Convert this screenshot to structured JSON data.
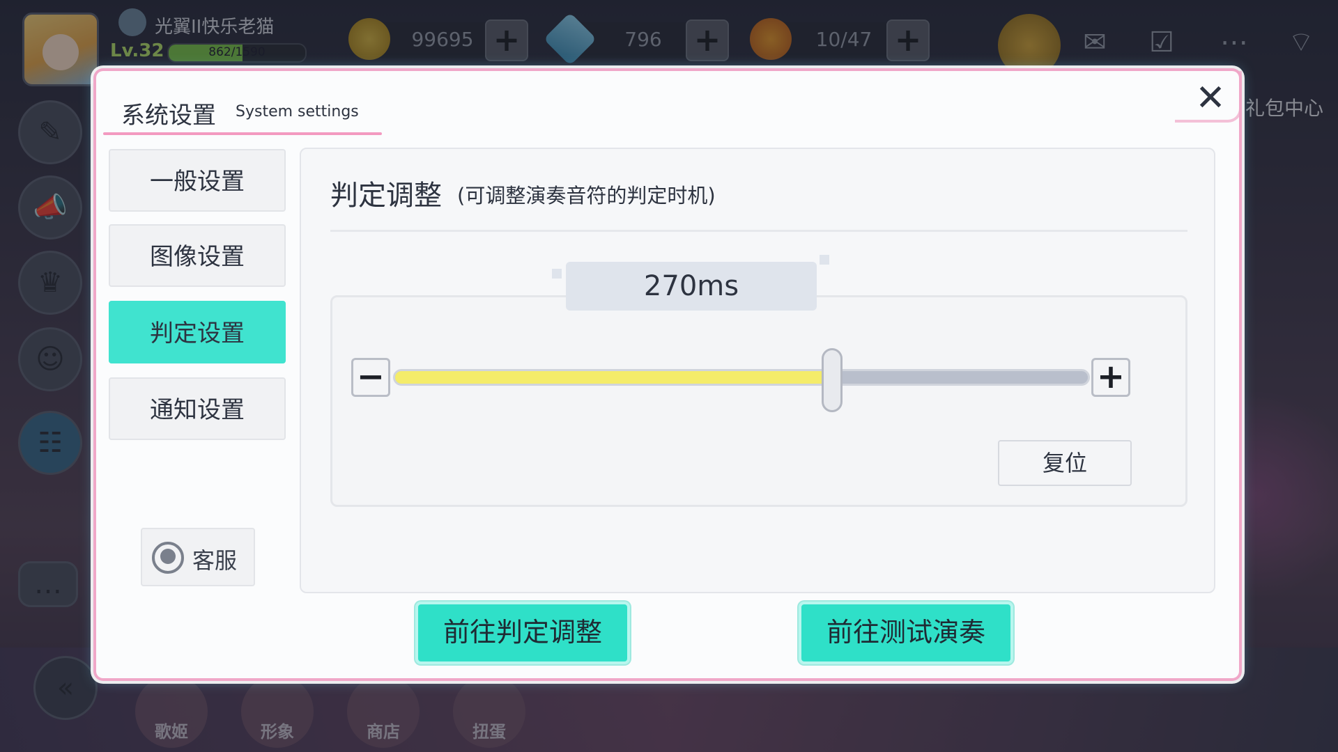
{
  "player": {
    "name": "光翼II快乐老猫",
    "level": "Lv.32",
    "exp_text": "862/1590",
    "exp_fraction": 0.542
  },
  "resources": [
    {
      "icon": "gold-coin-icon",
      "value": "99695"
    },
    {
      "icon": "diamond-icon",
      "value": "796"
    },
    {
      "icon": "stamina-sun-icon",
      "value": "10/47"
    }
  ],
  "right_panel": {
    "gift_center": "礼包中心"
  },
  "bottom_nav": [
    "歌姬",
    "形象",
    "商店",
    "扭蛋"
  ],
  "modal": {
    "title_cn": "系统设置",
    "title_en": "System settings",
    "close": "✕"
  },
  "side_nav": {
    "items": [
      "一般设置",
      "图像设置",
      "判定设置",
      "通知设置"
    ],
    "active_index": 2,
    "service_label": "客服"
  },
  "judgement": {
    "title": "判定调整",
    "subtitle": "(可调整演奏音符的判定时机)",
    "value_label": "270ms",
    "slider_fraction": 0.63,
    "minus": "−",
    "plus": "+",
    "reset_label": "复位"
  },
  "actions": {
    "goto_adjust": "前往判定调整",
    "goto_test": "前往测试演奏"
  },
  "colors": {
    "accent_teal": "#40e3cf",
    "slider_fill": "#f4ec6a",
    "modal_border_pink": "#f0a7c8"
  }
}
